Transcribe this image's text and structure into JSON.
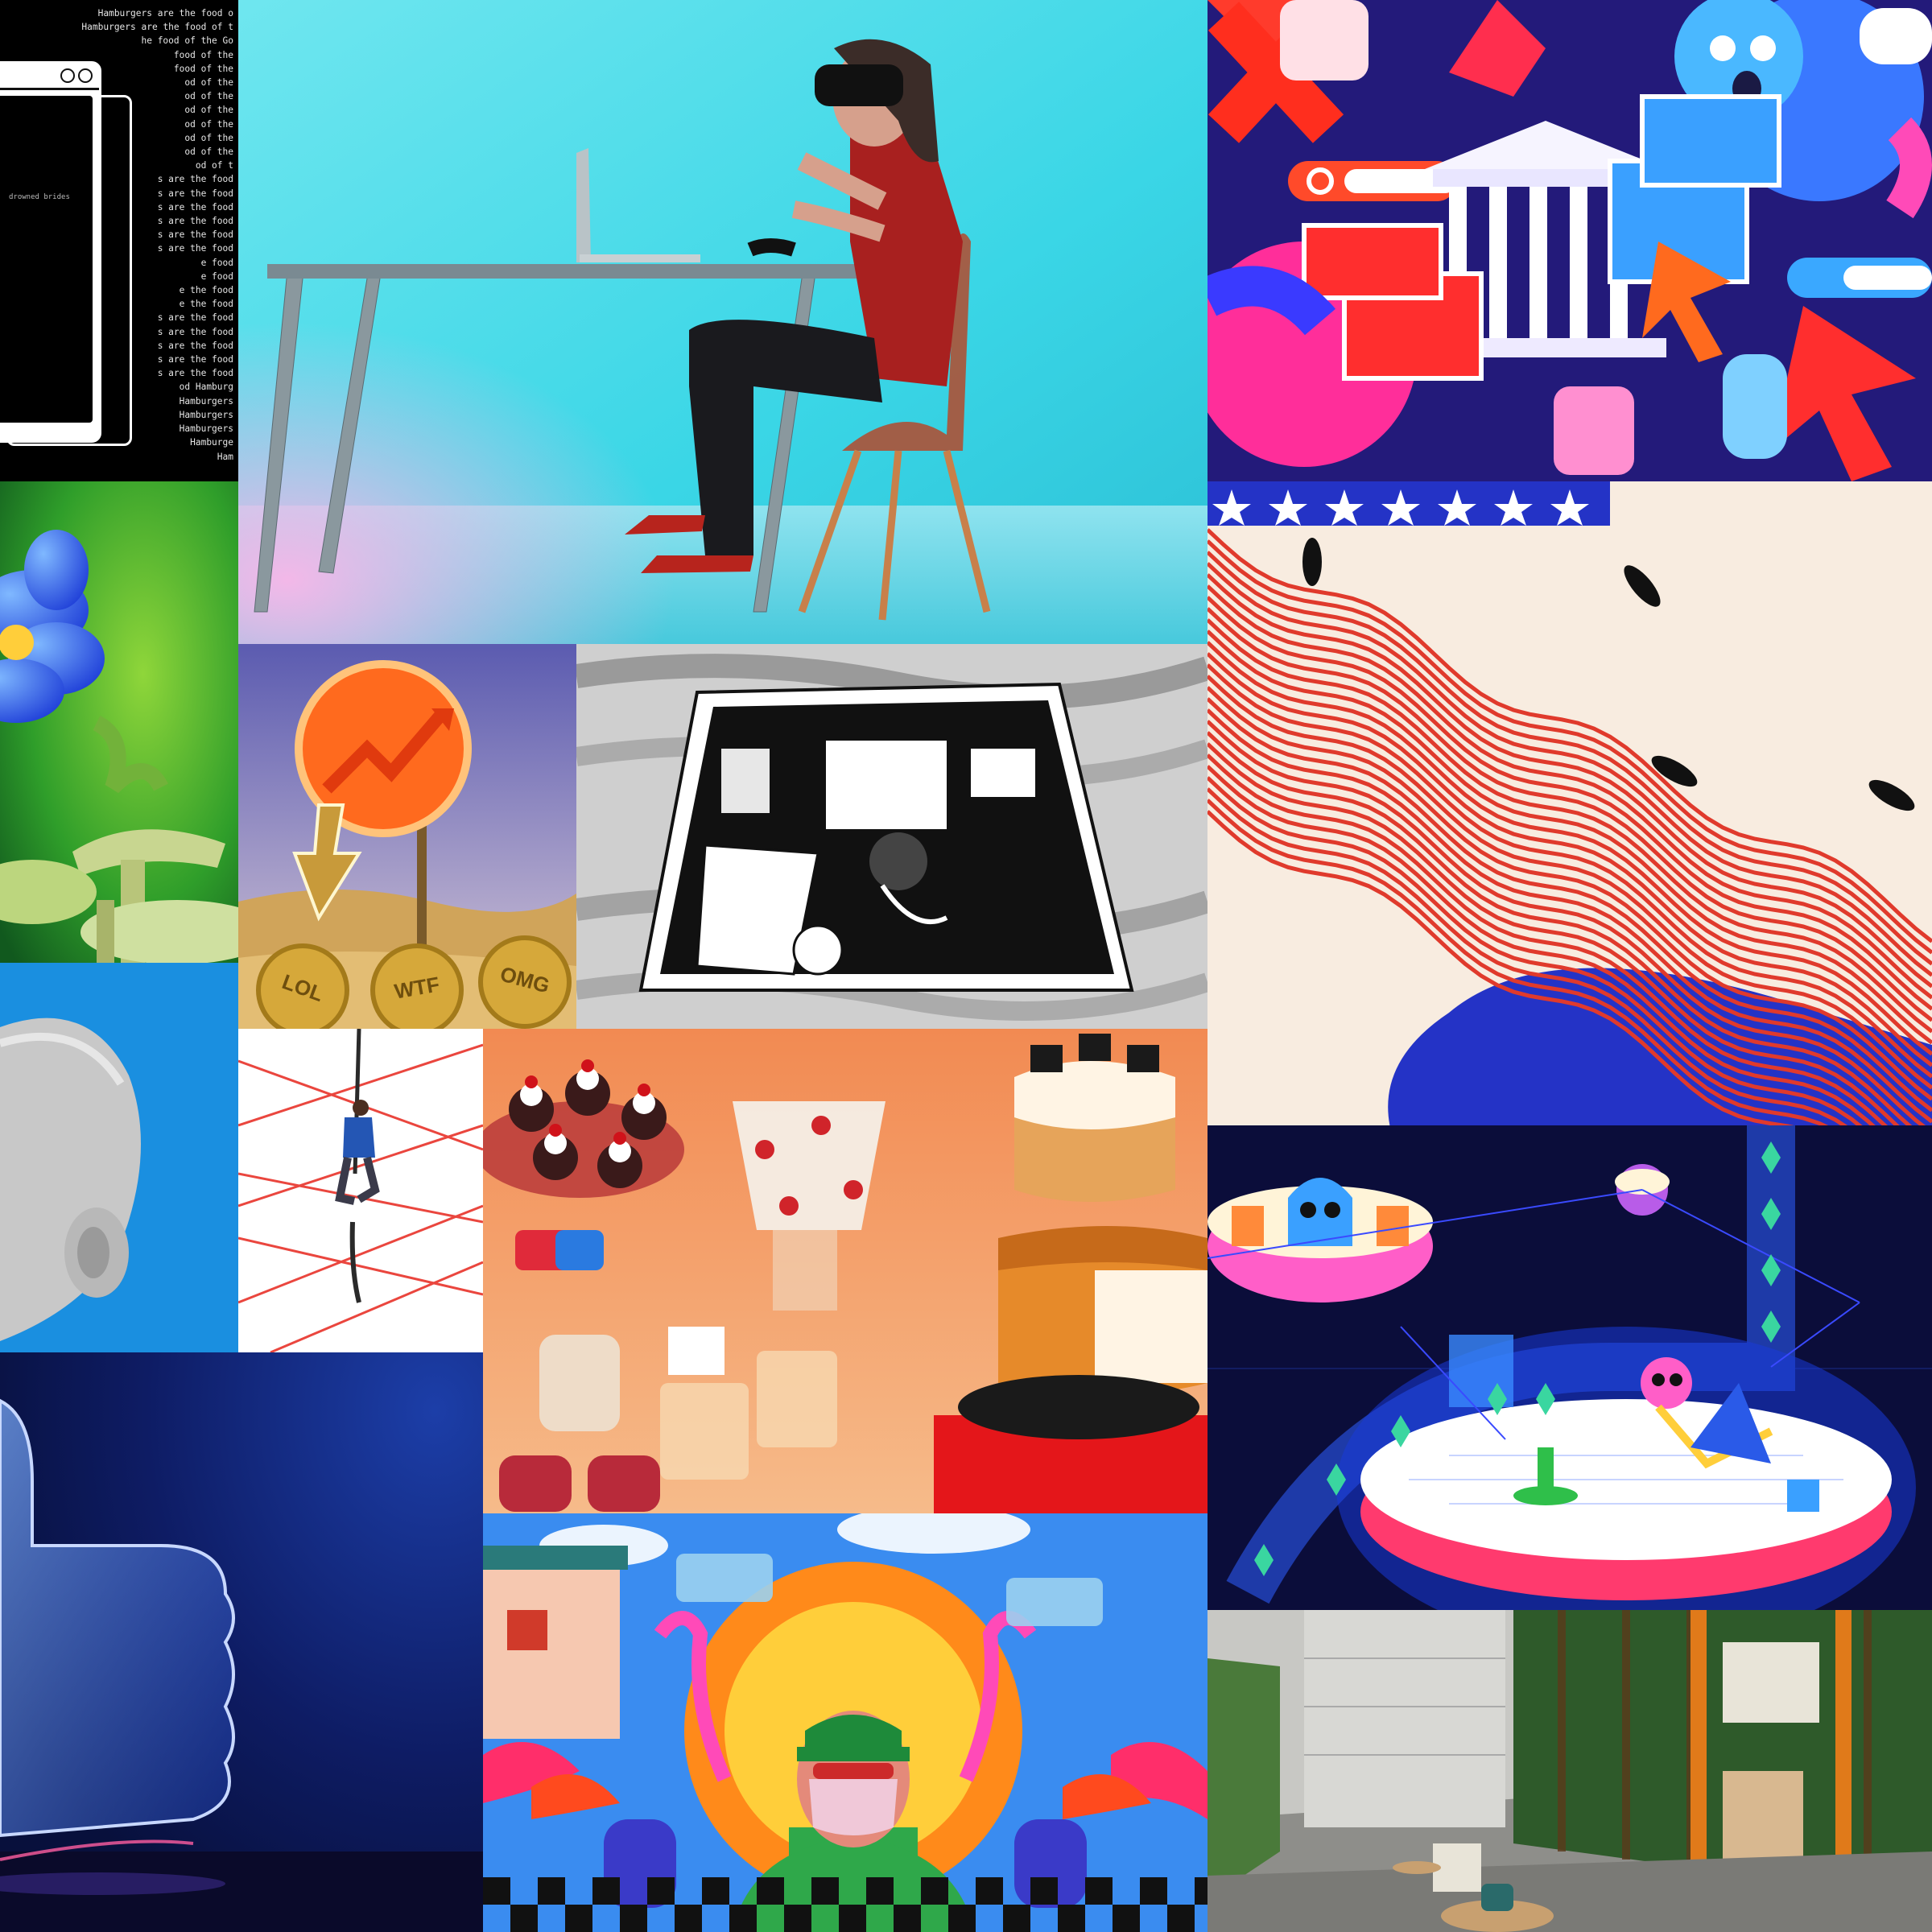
{
  "collage": {
    "type": "editorial illustration collage",
    "tiles": 16
  },
  "hamburger_tile": {
    "lines": [
      "Hamburgers are the food o",
      "Hamburgers are the food of t",
      "he food of the Go",
      "food of the",
      "food of the",
      "od of the",
      "od of the",
      "od of the",
      "od of the",
      "od of the",
      "od of the",
      "od of t",
      "s are the food",
      "s are the food",
      "s are the food",
      "s are the food",
      "s are the food",
      "s are the food",
      "e food",
      "e food",
      "e the food",
      "e the food",
      "s are the food",
      "s are the food",
      "s are the food",
      "s are the food",
      "s are the food",
      "od Hamburg",
      "Hamburgers",
      "Hamburgers",
      "Hamburgers",
      "Hamburge",
      "Ham"
    ],
    "window_text": "drowned brides"
  },
  "coin_tile": {
    "coins": [
      "LOL",
      "WTF",
      "OMG"
    ]
  },
  "colors": {
    "cyan_bg": "#3ad6e6",
    "blue_bg": "#1a8fe0",
    "navy_bg": "#0b0d3a",
    "stripe_red": "#e03a2c",
    "cream": "#f8ece0",
    "royal_blue": "#2433c6"
  }
}
